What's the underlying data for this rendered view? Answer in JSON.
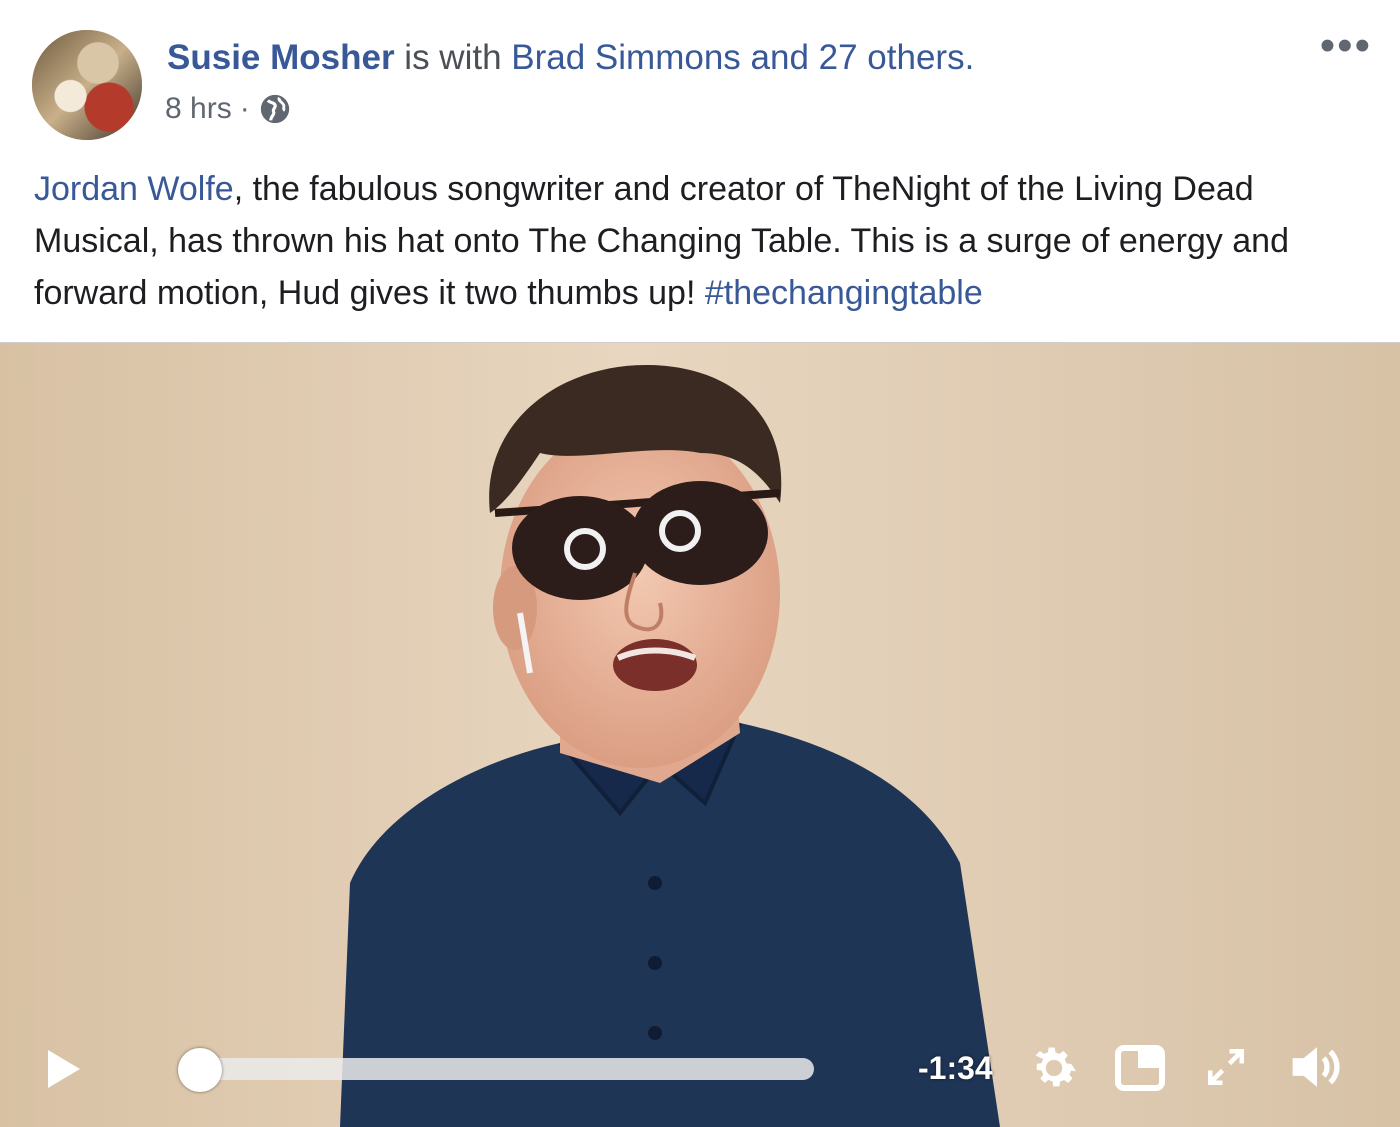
{
  "post": {
    "author": "Susie Mosher",
    "with_text": " is with ",
    "tagged": "Brad Simmons and 27 others.",
    "time": "8 hrs",
    "separator": "·",
    "more_label": "•••",
    "text_link": "Jordan Wolfe",
    "text_body": ", the fabulous songwriter and creator of TheNight of the Living Dead Musical, has thrown his hat onto The Changing Table. This is a surge of energy and forward motion, Hud gives it two thumbs up! ",
    "hashtag": "#thechangingtable"
  },
  "video": {
    "time_remaining": "-1:34",
    "progress": 0.0,
    "icons": [
      "play-icon",
      "gear-icon",
      "picture-in-picture-icon",
      "fullscreen-icon",
      "volume-icon"
    ]
  }
}
